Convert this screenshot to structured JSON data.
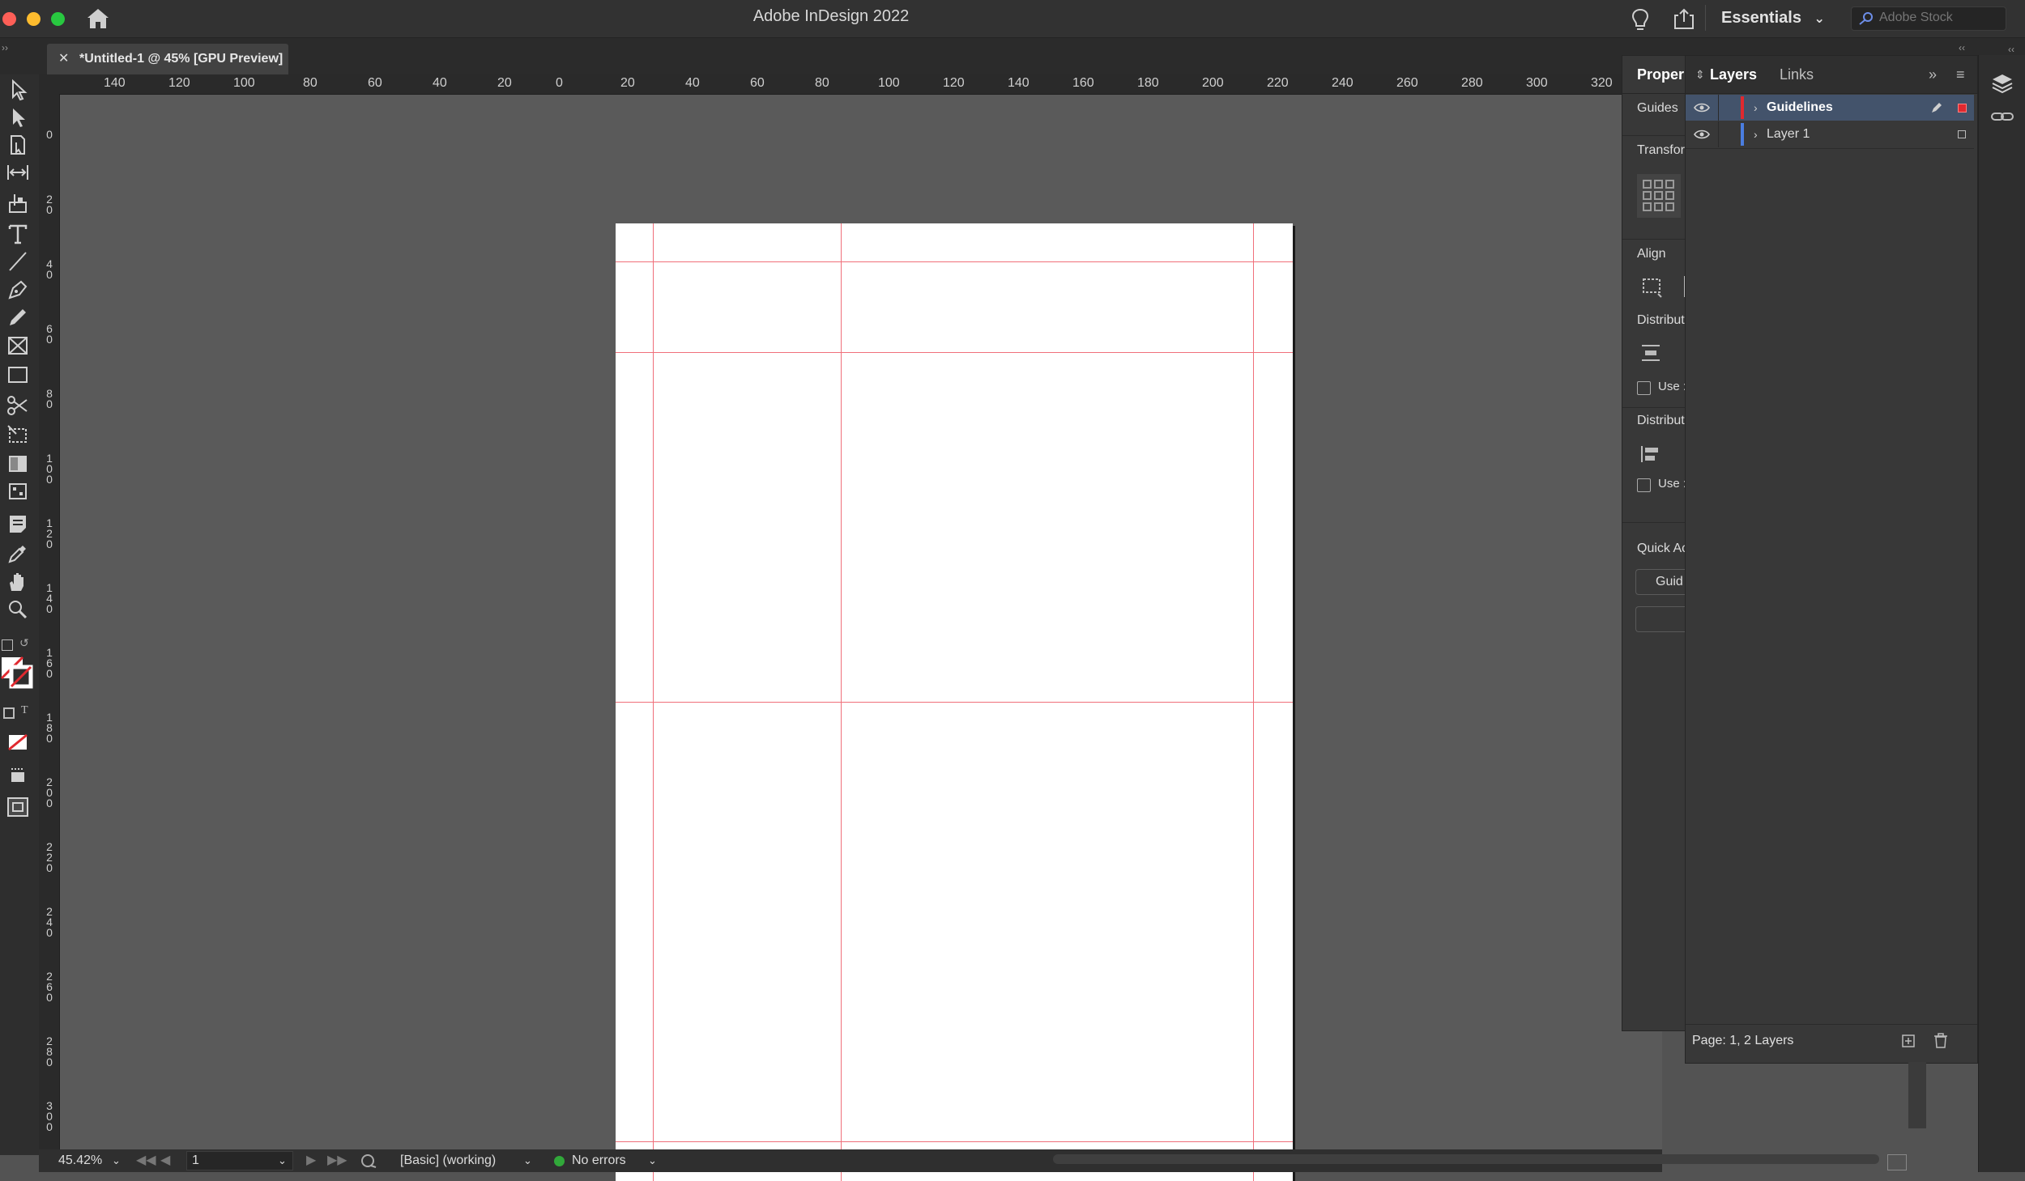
{
  "window": {
    "title": "Adobe InDesign 2022",
    "workspace": "Essentials",
    "stock_search_placeholder": "Adobe Stock"
  },
  "document_tab": {
    "label": "*Untitled-1 @ 45% [GPU Preview]"
  },
  "rulers": {
    "horizontal": [
      "140",
      "120",
      "100",
      "80",
      "60",
      "40",
      "20",
      "0",
      "20",
      "40",
      "60",
      "80",
      "100",
      "120",
      "140",
      "160",
      "180",
      "200",
      "220",
      "240",
      "260",
      "280",
      "300",
      "320"
    ],
    "vertical": [
      "0",
      "20",
      "40",
      "60",
      "80",
      "100",
      "120",
      "140",
      "160",
      "180",
      "200",
      "220",
      "240",
      "260",
      "280",
      "300"
    ]
  },
  "properties_panel": {
    "tab_label": "Proper",
    "guides_label": "Guides",
    "transform_label": "Transfor",
    "align_label": "Align",
    "distribute_label": "Distribut",
    "use_spacing_label": "Use :",
    "distribute_spacing_label": "Distribut",
    "use_spacing_label_2": "Use :",
    "quick_actions_label": "Quick Ac",
    "quick_action_button": "Guid"
  },
  "layers_panel": {
    "tabs": [
      "Layers",
      "Links"
    ],
    "layers": [
      {
        "name": "Guidelines",
        "color": "#e0292f",
        "selected": true
      },
      {
        "name": "Layer 1",
        "color": "#4a7de0",
        "selected": false
      }
    ],
    "footer": "Page: 1, 2 Layers"
  },
  "status_bar": {
    "zoom": "45.42%",
    "page": "1",
    "preflight_profile": "[Basic] (working)",
    "preflight_status": "No errors"
  },
  "colors": {
    "guide": "#f06f7a",
    "selected_layer_bg": "#43536b",
    "status_ok": "#31a83a"
  }
}
